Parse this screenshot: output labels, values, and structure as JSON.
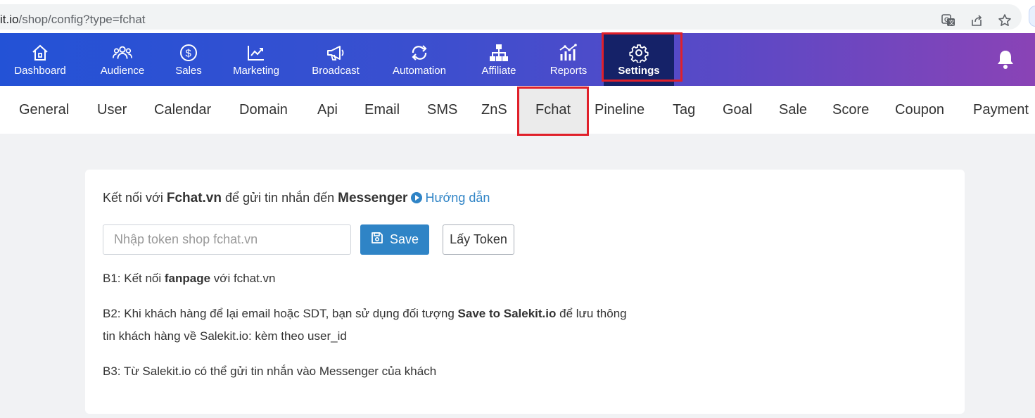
{
  "browser": {
    "url_visible": "it.io",
    "url_path": "/shop/config?type=fchat",
    "icons": [
      "translate-icon",
      "share-icon",
      "star-icon"
    ]
  },
  "topnav": {
    "items": [
      {
        "label": "Dashboard",
        "icon": "home-icon"
      },
      {
        "label": "Audience",
        "icon": "users-icon"
      },
      {
        "label": "Sales",
        "icon": "dollar-icon"
      },
      {
        "label": "Marketing",
        "icon": "chart-line-icon"
      },
      {
        "label": "Broadcast",
        "icon": "megaphone-icon"
      },
      {
        "label": "Automation",
        "icon": "refresh-icon"
      },
      {
        "label": "Affiliate",
        "icon": "sitemap-icon"
      },
      {
        "label": "Reports",
        "icon": "bar-chart-icon"
      },
      {
        "label": "Settings",
        "icon": "gear-icon",
        "active": true
      }
    ],
    "bell_icon": "bell-icon"
  },
  "subtabs": {
    "items": [
      "General",
      "User",
      "Calendar",
      "Domain",
      "Api",
      "Email",
      "SMS",
      "ZnS",
      "Fchat",
      "Pineline",
      "Tag",
      "Goal",
      "Sale",
      "Score",
      "Coupon",
      "Payment"
    ],
    "active": "Fchat"
  },
  "card": {
    "intro_prefix": "Kết nối với ",
    "intro_brand": "Fchat.vn",
    "intro_mid": " để gửi tin nhắn đến ",
    "intro_target": "Messenger",
    "guide_label": "Hướng dẫn",
    "token_placeholder": "Nhập token shop fchat.vn",
    "save_label": "Save",
    "get_token_label": "Lấy Token",
    "step1_prefix": "B1: Kết nối ",
    "step1_bold": "fanpage",
    "step1_suffix": " với fchat.vn",
    "step2_prefix": "B2: Khi khách hàng để lại email hoặc SDT, bạn sử dụng đối tượng ",
    "step2_bold": "Save to Salekit.io",
    "step2_suffix": " để lưu thông",
    "step2_line2": "tin khách hàng về Salekit.io: kèm theo user_id",
    "step3": "B3: Từ Salekit.io có thể gửi tin nhắn vào Messenger của khách"
  },
  "colors": {
    "nav_gradient_start": "#2352d6",
    "nav_gradient_end": "#8a43b6",
    "nav_active": "#152268",
    "primary": "#2f84c6",
    "highlight": "#e0202a"
  }
}
